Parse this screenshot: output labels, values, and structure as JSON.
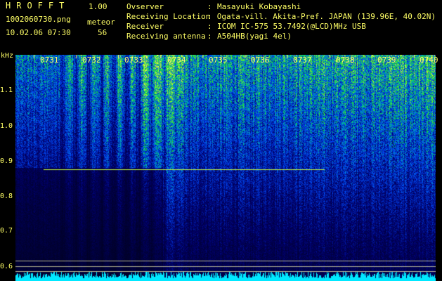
{
  "header": {
    "app_title": "HROFFT",
    "app_version": "1.00",
    "filename": "1002060730.png",
    "datetime": "10.02.06 07:30",
    "mode_label": "meteor",
    "count": "56"
  },
  "info": [
    {
      "key": "Ovserver",
      "value": "Masayuki Kobayashi"
    },
    {
      "key": "Receiving Location",
      "value": "Ogata-vill. Akita-Pref. JAPAN (139.96E, 40.02N)"
    },
    {
      "key": "Receiver",
      "value": "ICOM IC-575 53.7492(@LCD)MHz USB"
    },
    {
      "key": "Receiving antenna",
      "value": "A504HB(yagi 4el)"
    }
  ],
  "spectrogram": {
    "y_unit": "kHz",
    "y_ticks": [
      "1.1",
      "1.0",
      "0.9",
      "0.8",
      "0.7",
      "0.6"
    ],
    "time_ticks": [
      "0731",
      "0732",
      "0733",
      "0734",
      "0735",
      "0736",
      "0737",
      "0738",
      "0739",
      "0740"
    ],
    "colors": {
      "low": "#00002a",
      "mid": "#0050ff",
      "high": "#00d060",
      "top": "#b0ff40",
      "label": "#ffff66",
      "carrier": "#c8ff40"
    }
  }
}
